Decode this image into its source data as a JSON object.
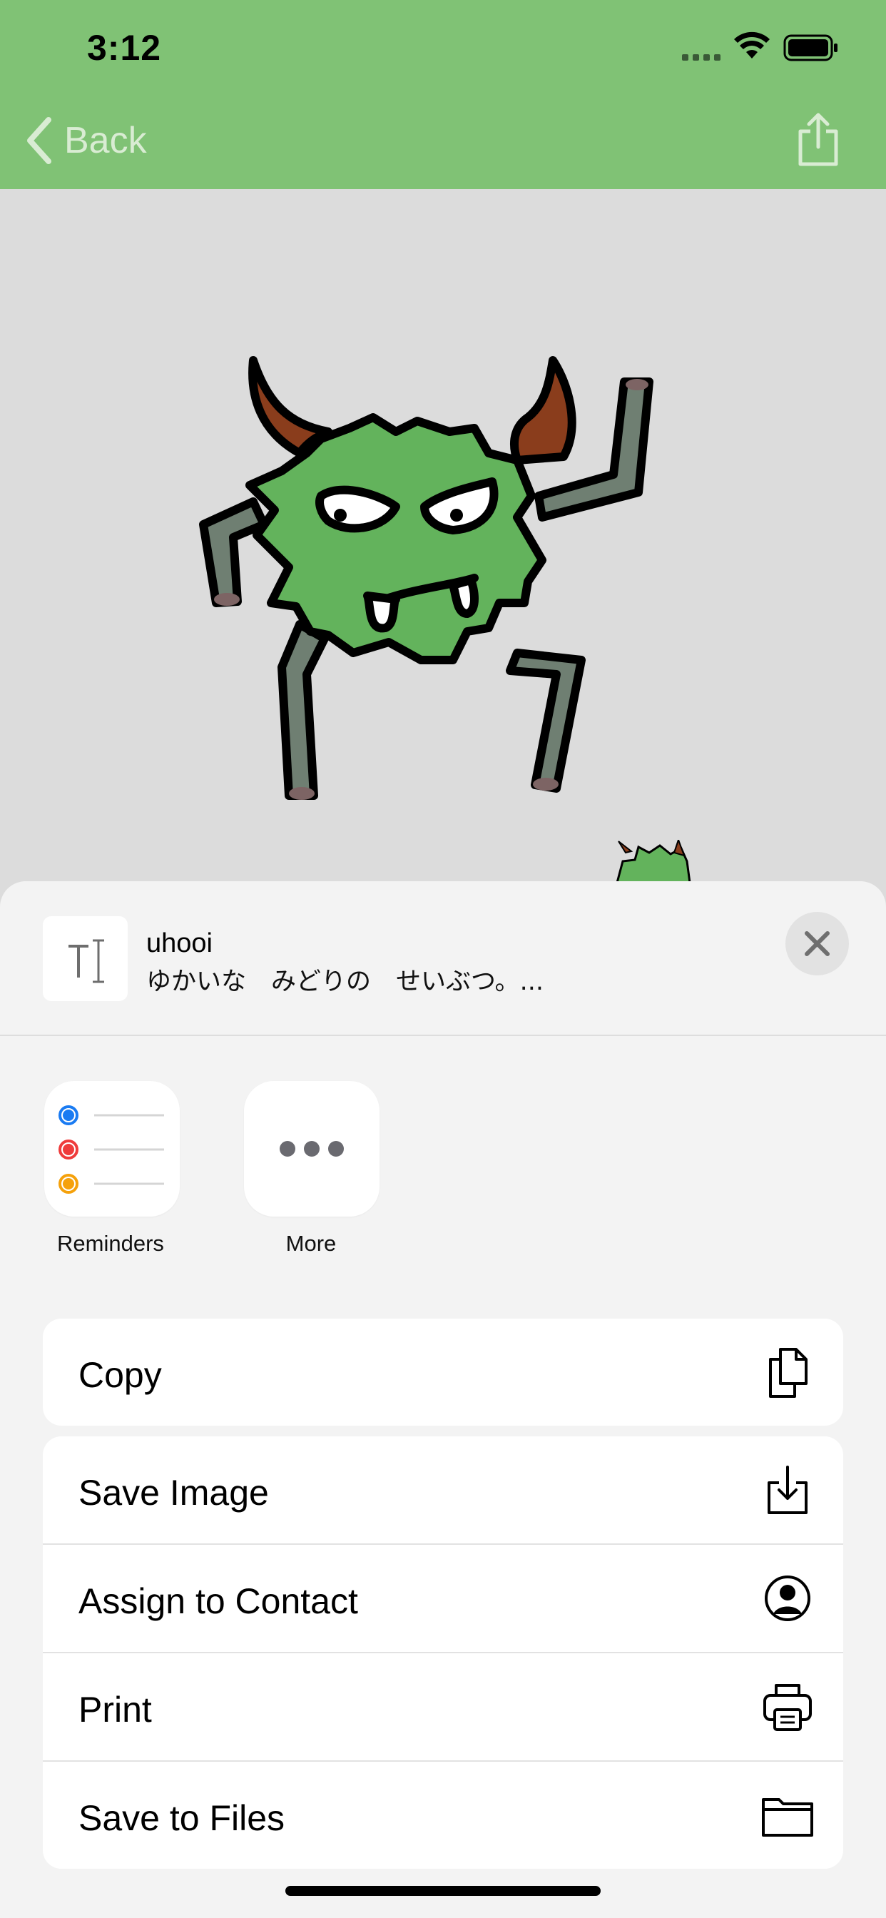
{
  "status_bar": {
    "time": "3:12"
  },
  "navbar": {
    "back_label": "Back",
    "back_icon": "chevron-left-icon",
    "share_icon": "share-icon",
    "tint": "#80c275"
  },
  "share_sheet": {
    "preview": {
      "title": "uhooi",
      "subtitle": "ゆかいな　みどりの　せいぶつ。...",
      "icon": "text-document-icon"
    },
    "close_icon": "close-icon",
    "apps": [
      {
        "label": "Reminders",
        "icon": "reminders-icon"
      },
      {
        "label": "More",
        "icon": "more-icon"
      }
    ],
    "actions_primary": [
      {
        "label": "Copy",
        "icon": "copy-icon"
      }
    ],
    "actions_secondary": [
      {
        "label": "Save Image",
        "icon": "save-image-icon"
      },
      {
        "label": "Assign to Contact",
        "icon": "contact-icon"
      },
      {
        "label": "Print",
        "icon": "printer-icon"
      },
      {
        "label": "Save to Files",
        "icon": "folder-icon"
      }
    ]
  }
}
